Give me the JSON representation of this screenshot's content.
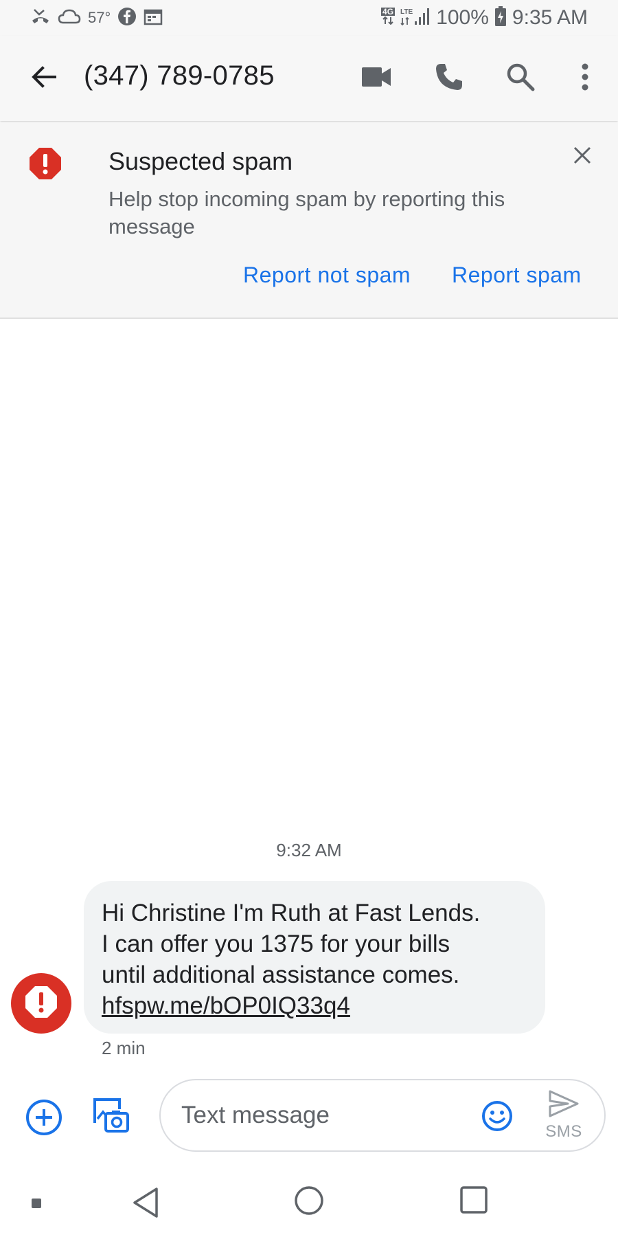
{
  "status_bar": {
    "temperature": "57°",
    "network": "4G",
    "lte": "LTE",
    "battery": "100%",
    "time": "9:35 AM"
  },
  "header": {
    "title": "(347) 789-0785",
    "icons": [
      "back-arrow-icon",
      "video-call-icon",
      "phone-icon",
      "search-icon",
      "more-vert-icon"
    ]
  },
  "spam_banner": {
    "title": "Suspected spam",
    "body": "Help stop incoming spam by reporting this message",
    "report_not_spam_label": "Report not spam",
    "report_spam_label": "Report spam"
  },
  "conversation": {
    "timestamp": "9:32 AM",
    "message": {
      "text": "Hi Christine I'm Ruth at Fast Lends.\nI can offer you 1375 for your bills\nuntil additional assistance comes.",
      "link": "hfspw.me/bOP0IQ33q4",
      "age": "2 min"
    }
  },
  "compose": {
    "placeholder": "Text message",
    "send_label": "SMS"
  },
  "colors": {
    "accent": "#1a73e8",
    "spam_red": "#d93025",
    "bubble_bg": "#f1f3f4",
    "banner_bg": "#f6f6f6"
  }
}
